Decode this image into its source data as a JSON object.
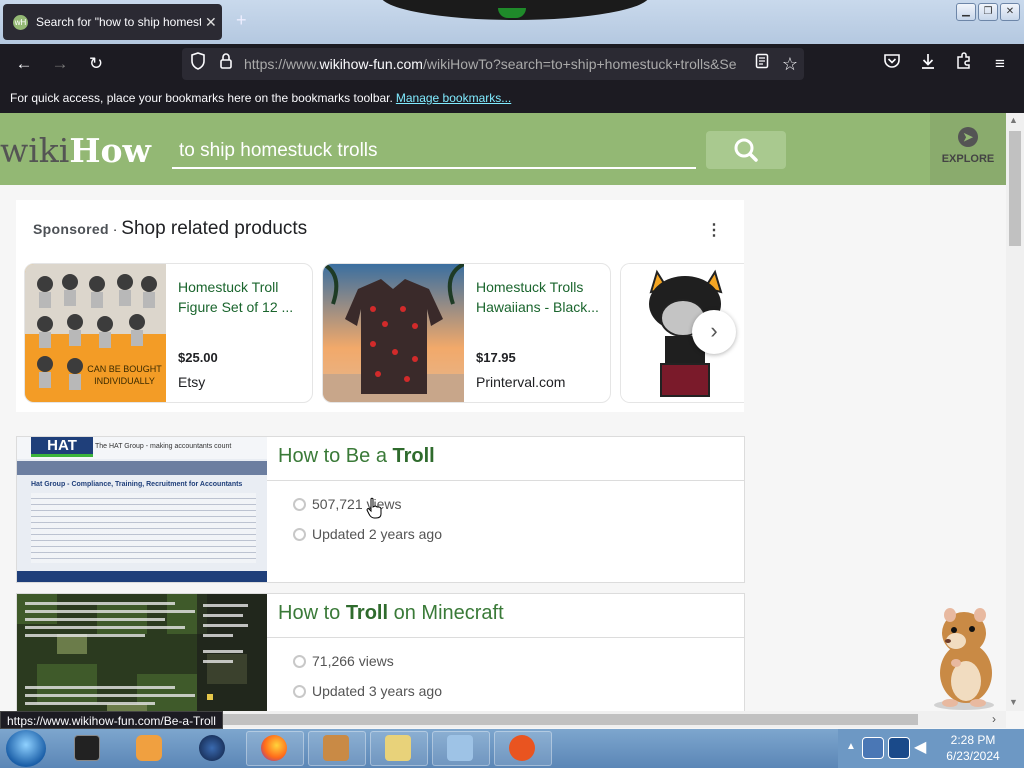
{
  "browser": {
    "tab_title": "Search for \"how to ship homest",
    "tab_favicon_text": "wH",
    "new_tab_symbol": "+",
    "url_prefix": "https://www.",
    "url_domain": "wikihow-fun.com",
    "url_rest": "/wikiHowTo?search=to+ship+homestuck+trolls&Se",
    "bookmarks_message": "For quick access, place your bookmarks here on the bookmarks toolbar.",
    "bookmarks_link": "Manage bookmarks..."
  },
  "site": {
    "logo_wiki": "wiki",
    "logo_how": "How",
    "search_value": "to ship homestuck trolls",
    "explore_label": "EXPLORE"
  },
  "sponsored": {
    "label": "Sponsored",
    "separator": "·",
    "title": "Shop related products",
    "menu_symbol": "⋮",
    "products": [
      {
        "name": "Homestuck Troll Figure Set of 12 ...",
        "price": "$25.00",
        "seller": "Etsy",
        "image_caption": "CAN BE BOUGHT INDIVIDUALLY"
      },
      {
        "name": "Homestuck Trolls Hawaiians - Black...",
        "price": "$17.95",
        "seller": "Printerval.com"
      }
    ]
  },
  "results": [
    {
      "title_pre": "How to Be a ",
      "title_bold": "Troll",
      "title_post": "",
      "views": "507,721 views",
      "updated": "Updated 2 years ago",
      "thumb_header": "The HAT Group - making accountants count",
      "thumb_subtitle": "Hat Group - Compliance, Training, Recruitment for Accountants",
      "thumb_logo": "HAT"
    },
    {
      "title_pre": "How to ",
      "title_bold": "Troll",
      "title_post": " on Minecraft",
      "views": "71,266 views",
      "updated": "Updated 3 years ago"
    }
  ],
  "status_url": "https://www.wikihow-fun.com/Be-a-Troll",
  "taskbar": {
    "time": "2:28 PM",
    "date": "6/23/2024"
  }
}
